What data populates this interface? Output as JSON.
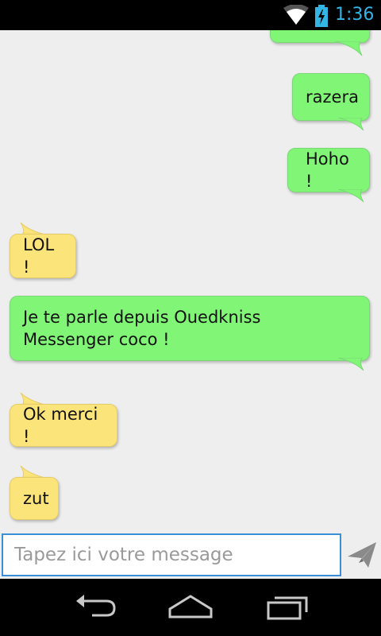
{
  "status_bar": {
    "time": "1:36",
    "icons": [
      "wifi-icon",
      "battery-charging-icon"
    ],
    "accent_color": "#33b5e5"
  },
  "messages": [
    {
      "type": "sent",
      "text": ""
    },
    {
      "type": "sent",
      "text": "razera"
    },
    {
      "type": "sent",
      "text": "Hoho !"
    },
    {
      "type": "received",
      "text": "LOL !"
    },
    {
      "type": "sent",
      "text": "Je te parle depuis Ouedkniss Messenger coco !"
    },
    {
      "type": "received",
      "text": "Ok merci !"
    },
    {
      "type": "received",
      "text": "zut"
    }
  ],
  "composer": {
    "placeholder": "Tapez ici votre message",
    "value": "",
    "send_icon": "send-icon"
  },
  "nav_bar": {
    "icons": [
      "back-icon",
      "home-icon",
      "recent-apps-icon"
    ]
  },
  "colors": {
    "sent_bubble": "#80f576",
    "received_bubble": "#fbe479",
    "chat_background": "#eeeeee",
    "input_border": "#3b8fd8"
  }
}
